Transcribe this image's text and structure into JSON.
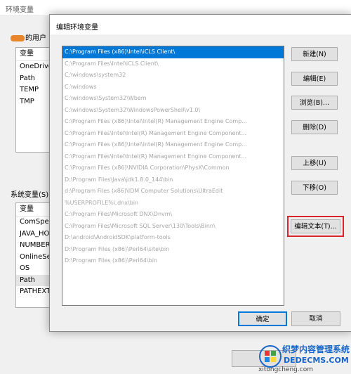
{
  "back_window": {
    "title": "环境变量",
    "user_section_label": "的用户",
    "user_vars": {
      "header": "变量",
      "rows": [
        "OneDrive",
        "Path",
        "TEMP",
        "TMP"
      ]
    },
    "system_section_label": "系统变量(S)",
    "system_vars": {
      "header": "变量",
      "rows": [
        "ComSpec",
        "JAVA_HO",
        "NUMBER",
        "OnlineSer",
        "OS",
        "Path",
        "PATHEXT"
      ]
    }
  },
  "dialog": {
    "title": "编辑环境变量",
    "paths": [
      "C:\\Program Files (x86)\\Intel\\iCLS Client\\",
      "C:\\Program Files\\Intel\\iCLS Client\\",
      "C:\\windows\\system32",
      "C:\\windows",
      "C:\\windows\\System32\\Wbem",
      "C:\\windows\\System32\\WindowsPowerShell\\v1.0\\",
      "C:\\Program Files (x86)\\Intel\\Intel(R) Management Engine Comp...",
      "C:\\Program Files\\Intel\\Intel(R) Management Engine Component...",
      "C:\\Program Files (x86)\\Intel\\Intel(R) Management Engine Comp...",
      "C:\\Program Files\\Intel\\Intel(R) Management Engine Component...",
      "C:\\Program Files (x86)\\NVIDIA Corporation\\PhysX\\Common",
      "D:\\Program Files\\Java\\jdk1.8.0_144\\bin",
      "d:\\Program Files (x86)\\IDM Computer Solutions\\UltraEdit",
      "%USERPROFILE%\\.dnx\\bin",
      "C:\\Program Files\\Microsoft DNX\\Dnvm\\",
      "C:\\Program Files\\Microsoft SQL Server\\130\\Tools\\Binn\\",
      "D:\\android\\AndroidSDK\\platform-tools",
      "D:\\Program Files (x86)\\Perl64\\site\\bin",
      "D:\\Program Files (x86)\\Perl64\\bin"
    ],
    "buttons": {
      "new": "新建(N)",
      "edit": "编辑(E)",
      "browse": "浏览(B)...",
      "delete": "删除(D)",
      "move_up": "上移(U)",
      "move_down": "下移(O)",
      "edit_text": "编辑文本(T)...",
      "ok": "确定",
      "cancel": "取消"
    }
  },
  "watermark": {
    "line1": "织梦内容管理系统",
    "line2": "DEDECMS.COM",
    "line3": "xitongcheng.com"
  },
  "colors": {
    "selection": "#0078d7",
    "highlight_box": "#d9242b",
    "watermark": "#1a66c8"
  }
}
